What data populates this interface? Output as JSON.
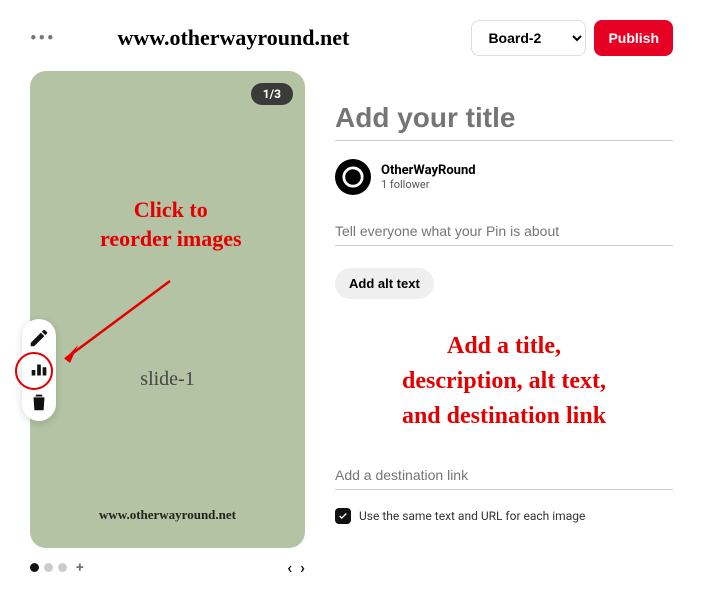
{
  "topbar": {
    "watermark": "www.otherwayround.net",
    "board_selected": "Board-2",
    "publish_label": "Publish"
  },
  "slide": {
    "counter": "1/3",
    "label": "slide-1",
    "watermark": "www.otherwayround.net"
  },
  "annotations": {
    "reorder": "Click to\nreorder images",
    "right_hint": "Add a title,\ndescription, alt text,\nand destination link"
  },
  "form": {
    "title_placeholder": "Add your title",
    "desc_placeholder": "Tell everyone what your Pin is about",
    "alt_button": "Add alt text",
    "dest_placeholder": "Add a destination link",
    "checkbox_label": "Use the same text and URL for each image"
  },
  "profile": {
    "name": "OtherWayRound",
    "sub": "1 follower"
  }
}
